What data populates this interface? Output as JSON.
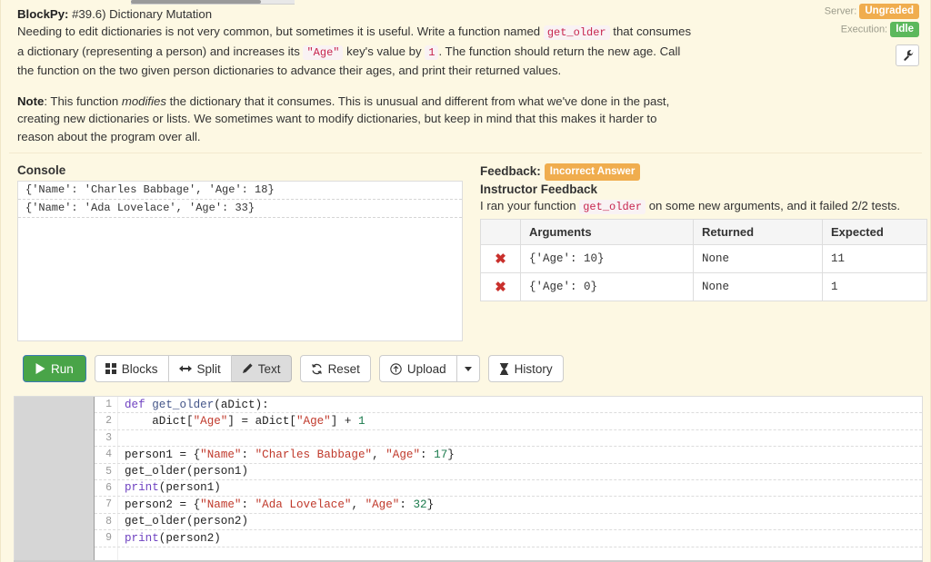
{
  "app": {
    "name": "BlockPy",
    "assignment_id": "#39.6)",
    "assignment_title": "Dictionary Mutation"
  },
  "instructions": {
    "title_prefix": "BlockPy:",
    "title_rest": " #39.6) Dictionary Mutation",
    "p1_a": "Needing to edit dictionaries is not very common, but sometimes it is useful. Write a function named ",
    "p1_code1": "get_older",
    "p1_b": " that consumes a dictionary (representing a person) and increases its ",
    "p1_code2": "\"Age\"",
    "p1_c": " key's value by ",
    "p1_code3": "1",
    "p1_d": ". The function should return the new age. Call the function on the two given person dictionaries to advance their ages, and print their returned values.",
    "note_label": "Note",
    "p2_a": ": This function ",
    "p2_em": "modifies",
    "p2_b": " the dictionary that it consumes. This is unusual and different from what we've done in the past, creating new dictionaries or lists. We sometimes want to modify dictionaries, but keep in mind that this makes it harder to reason about the program over all."
  },
  "status": {
    "server_label": "Server:",
    "server_value": "Ungraded",
    "server_color": "#f0ad4e",
    "execution_label": "Execution:",
    "execution_value": "Idle",
    "execution_color": "#5cb85c",
    "settings_icon": "wrench-icon"
  },
  "console": {
    "title": "Console",
    "lines": [
      "{'Name': 'Charles Babbage', 'Age': 18}",
      "{'Name': 'Ada Lovelace', 'Age': 33}"
    ]
  },
  "feedback": {
    "title": "Feedback:",
    "status_badge": "Incorrect Answer",
    "status_color": "#f0ad4e",
    "subtitle": "Instructor Feedback",
    "message_a": "I ran your function ",
    "message_code": "get_older",
    "message_b": " on some new arguments, and it failed 2/2 tests.",
    "table": {
      "headers": [
        "",
        "Arguments",
        "Returned",
        "Expected"
      ],
      "rows": [
        {
          "mark": "✖",
          "arguments": "{'Age': 10}",
          "returned": "None",
          "expected": "11"
        },
        {
          "mark": "✖",
          "arguments": "{'Age': 0}",
          "returned": "None",
          "expected": "1"
        }
      ]
    }
  },
  "toolbar": {
    "run_label": "Run",
    "run_icon": "play-icon",
    "blocks_label": "Blocks",
    "blocks_icon": "grid-icon",
    "split_label": "Split",
    "split_icon": "arrows-horizontal-icon",
    "text_label": "Text",
    "text_icon": "pencil-icon",
    "reset_label": "Reset",
    "reset_icon": "refresh-icon",
    "upload_label": "Upload",
    "upload_icon": "upload-circle-icon",
    "upload_caret_icon": "caret-down-icon",
    "history_label": "History",
    "history_icon": "hourglass-icon"
  },
  "editor": {
    "lines": [
      {
        "n": "1",
        "tokens": [
          {
            "t": "def ",
            "c": "kw"
          },
          {
            "t": "get_older",
            "c": "def"
          },
          {
            "t": "(aDict):",
            "c": ""
          }
        ]
      },
      {
        "n": "2",
        "tokens": [
          {
            "t": "    aDict[",
            "c": ""
          },
          {
            "t": "\"Age\"",
            "c": "str"
          },
          {
            "t": "] = aDict[",
            "c": ""
          },
          {
            "t": "\"Age\"",
            "c": "str"
          },
          {
            "t": "] + ",
            "c": ""
          },
          {
            "t": "1",
            "c": "num"
          }
        ]
      },
      {
        "n": "3",
        "tokens": [
          {
            "t": "",
            "c": ""
          }
        ]
      },
      {
        "n": "4",
        "tokens": [
          {
            "t": "person1 = {",
            "c": ""
          },
          {
            "t": "\"Name\"",
            "c": "str"
          },
          {
            "t": ": ",
            "c": ""
          },
          {
            "t": "\"Charles Babbage\"",
            "c": "str"
          },
          {
            "t": ", ",
            "c": ""
          },
          {
            "t": "\"Age\"",
            "c": "str"
          },
          {
            "t": ": ",
            "c": ""
          },
          {
            "t": "17",
            "c": "num"
          },
          {
            "t": "}",
            "c": ""
          }
        ]
      },
      {
        "n": "5",
        "tokens": [
          {
            "t": "get_older(person1)",
            "c": ""
          }
        ]
      },
      {
        "n": "6",
        "tokens": [
          {
            "t": "print",
            "c": "fn"
          },
          {
            "t": "(person1)",
            "c": ""
          }
        ]
      },
      {
        "n": "7",
        "tokens": [
          {
            "t": "person2 = {",
            "c": ""
          },
          {
            "t": "\"Name\"",
            "c": "str"
          },
          {
            "t": ": ",
            "c": ""
          },
          {
            "t": "\"Ada Lovelace\"",
            "c": "str"
          },
          {
            "t": ", ",
            "c": ""
          },
          {
            "t": "\"Age\"",
            "c": "str"
          },
          {
            "t": ": ",
            "c": ""
          },
          {
            "t": "32",
            "c": "num"
          },
          {
            "t": "}",
            "c": ""
          }
        ]
      },
      {
        "n": "8",
        "tokens": [
          {
            "t": "get_older(person2)",
            "c": ""
          }
        ]
      },
      {
        "n": "9",
        "tokens": [
          {
            "t": "print",
            "c": "fn"
          },
          {
            "t": "(person2)",
            "c": ""
          }
        ]
      },
      {
        "n": "",
        "tokens": [
          {
            "t": "",
            "c": ""
          }
        ]
      }
    ]
  }
}
